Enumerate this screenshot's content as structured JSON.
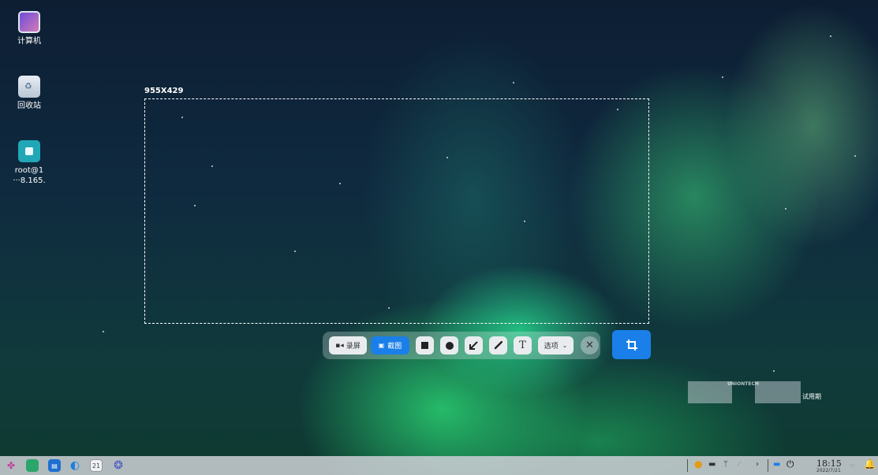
{
  "desktop": {
    "icons": [
      {
        "label": "计算机"
      },
      {
        "label": "回收站"
      },
      {
        "label": "root@1\n···8.165."
      }
    ]
  },
  "selection": {
    "size_label": "955X429"
  },
  "toolbar": {
    "record_label": "录屏",
    "screenshot_label": "截图",
    "text_tool": "T",
    "options_label": "选项",
    "close_glyph": "✕"
  },
  "watermark": {
    "brand": "UNIONTECH",
    "trial": "试用期"
  },
  "taskbar": {
    "clock_time": "18:15",
    "clock_date": "2022/7/21",
    "calendar_day": "21"
  },
  "colors": {
    "accent": "#1a7fe8",
    "taskbar": "#c8cdd2"
  }
}
